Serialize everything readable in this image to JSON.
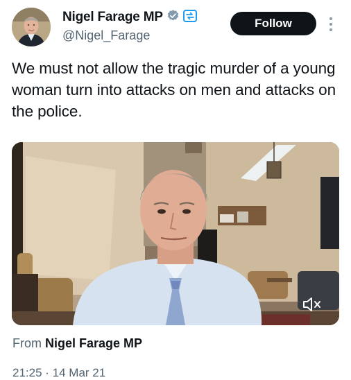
{
  "author": {
    "display_name": "Nigel Farage MP",
    "handle": "@Nigel_Farage",
    "verified_icon": "verified-badge-icon",
    "automated_icon": "automated-account-icon"
  },
  "actions": {
    "follow_label": "Follow",
    "more_icon": "more-vertical-icon"
  },
  "tweet": {
    "text": "We must not allow the tragic murder of a young woman turn into attacks on men and attacks on the police."
  },
  "media": {
    "type": "video",
    "mute_icon": "speaker-muted-icon",
    "mute_glyph": "🕨×"
  },
  "attribution": {
    "prefix": "From",
    "source_name": "Nigel Farage MP"
  },
  "meta": {
    "timestamp_partial": "21:25 · 14 Mar 21"
  },
  "colors": {
    "text": "#0f1419",
    "secondary": "#536471",
    "follow_bg": "#0f1419",
    "verified": "#829aab"
  }
}
